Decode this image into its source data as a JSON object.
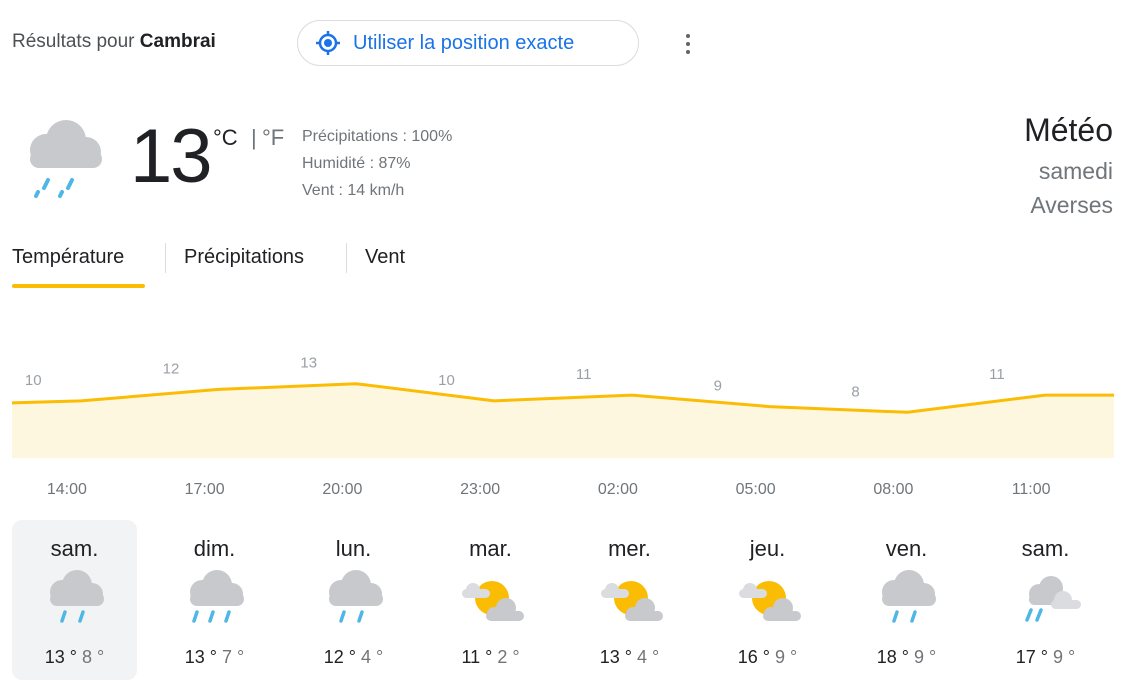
{
  "header": {
    "results_prefix": "Résultats pour",
    "location": "Cambrai",
    "position_button": "Utiliser la position exacte"
  },
  "current": {
    "temperature": "13",
    "unit_c": "°C",
    "unit_sep": "|",
    "unit_f": "°F",
    "precipitation": "Précipitations : 100%",
    "humidity": "Humidité : 87%",
    "wind": "Vent : 14 km/h",
    "title": "Météo",
    "day": "samedi",
    "condition": "Averses",
    "icon": "rain-cloud-icon"
  },
  "tabs": [
    {
      "label": "Température",
      "selected": true
    },
    {
      "label": "Précipitations",
      "selected": false
    },
    {
      "label": "Vent",
      "selected": false
    }
  ],
  "chart_data": {
    "type": "area",
    "x": [
      "14:00",
      "17:00",
      "20:00",
      "23:00",
      "02:00",
      "05:00",
      "08:00",
      "11:00"
    ],
    "values": [
      10,
      12,
      13,
      10,
      11,
      9,
      8,
      11
    ],
    "fill_color": "#fef7e0",
    "line_color": "#fbbc04"
  },
  "forecast": [
    {
      "day": "sam.",
      "hi": "13 °",
      "lo": "8 °",
      "icon": "rain-cloud-icon",
      "selected": true
    },
    {
      "day": "dim.",
      "hi": "13 °",
      "lo": "7 °",
      "icon": "heavy-rain-cloud-icon",
      "selected": false
    },
    {
      "day": "lun.",
      "hi": "12 °",
      "lo": "4 °",
      "icon": "rain-cloud-icon",
      "selected": false
    },
    {
      "day": "mar.",
      "hi": "11 °",
      "lo": "2 °",
      "icon": "partly-cloudy-icon",
      "selected": false
    },
    {
      "day": "mer.",
      "hi": "13 °",
      "lo": "4 °",
      "icon": "partly-cloudy-icon",
      "selected": false
    },
    {
      "day": "jeu.",
      "hi": "16 °",
      "lo": "9 °",
      "icon": "partly-cloudy-icon",
      "selected": false
    },
    {
      "day": "ven.",
      "hi": "18 °",
      "lo": "9 °",
      "icon": "rain-cloud-icon",
      "selected": false
    },
    {
      "day": "sam.",
      "hi": "17 °",
      "lo": "9 °",
      "icon": "showers-icon",
      "selected": false
    }
  ]
}
